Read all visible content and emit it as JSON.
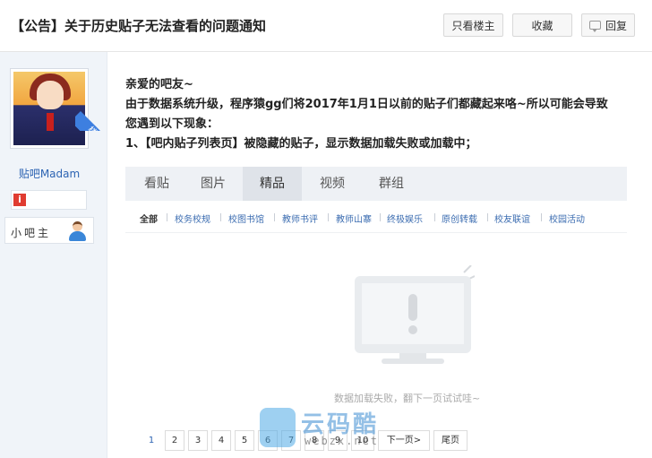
{
  "header": {
    "title": "【公告】关于历史贴子无法查看的问题通知",
    "buttons": {
      "only_op": "只看楼主",
      "favorite": "收藏",
      "reply": "回复"
    }
  },
  "author": {
    "owner_badge": "楼主",
    "name": "贴吧Madam",
    "info_icon": "i",
    "level_title": "小吧主"
  },
  "post": {
    "lines": [
      "亲爱的吧友~",
      "由于数据系统升级，程序猿gg们将2017年1月1日以前的贴子们都藏起来咯~所以可能会导致",
      "您遇到以下现象：",
      "1、【吧内贴子列表页】被隐藏的贴子，显示数据加载失败或加载中；"
    ]
  },
  "embed": {
    "tabs": [
      "看贴",
      "图片",
      "精品",
      "视频",
      "群组"
    ],
    "active_tab": "精品",
    "sub_nav": [
      "全部",
      "校务校规",
      "校图书馆",
      "教师书评",
      "教师山寨",
      "终极娱乐",
      "原创转载",
      "校友联谊",
      "校园活动"
    ],
    "error_message": "数据加载失败，翻下一页试试哇~",
    "pager": [
      "1",
      "2",
      "3",
      "4",
      "5",
      "6",
      "7",
      "8",
      "9",
      "10",
      "下一页>",
      "尾页"
    ],
    "current_page": "1"
  },
  "watermark": {
    "cn": "云码酷",
    "en": "webzx.net"
  },
  "icons": [
    "reply-icon",
    "info-icon",
    "user-icon",
    "monitor-icon",
    "exclamation-icon"
  ],
  "colors": {
    "link": "#2d64b3",
    "badge": "#3d7fe0",
    "info": "#e03c31"
  }
}
